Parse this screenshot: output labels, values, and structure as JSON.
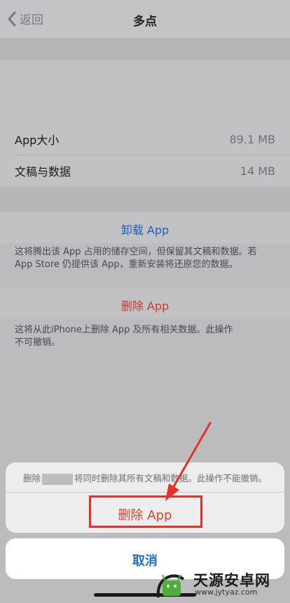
{
  "nav": {
    "back_label": "返回",
    "title": "多点"
  },
  "info": {
    "rows": [
      {
        "key": "App大小",
        "value": "89.1 MB"
      },
      {
        "key": "文稿与数据",
        "value": "14 MB"
      }
    ]
  },
  "offload": {
    "button_label": "卸载 App",
    "note_line1": "这将腾出该 App 占用的储存空间，但保留其文稿和数据。若",
    "note_line2": "App Store 仍提供该 App，重新安装将还原您的数据。"
  },
  "delete": {
    "button_label": "删除 App",
    "note_line1": "这将从此iPhone上删除 App 及所有相关数据。此操作",
    "note_line2": "不可撤销。"
  },
  "sheet": {
    "msg_prefix": "删除",
    "msg_suffix": "将同时删除其所有文稿和数据。此操作不能撤销。",
    "delete_label": "删除 App",
    "cancel_label": "取消"
  },
  "watermark": {
    "name": "天源安卓网",
    "url": "www.jytyaz.com"
  },
  "colors": {
    "blue": "#1f5fb8",
    "red": "#c93a32",
    "highlight": "#e3322a"
  }
}
